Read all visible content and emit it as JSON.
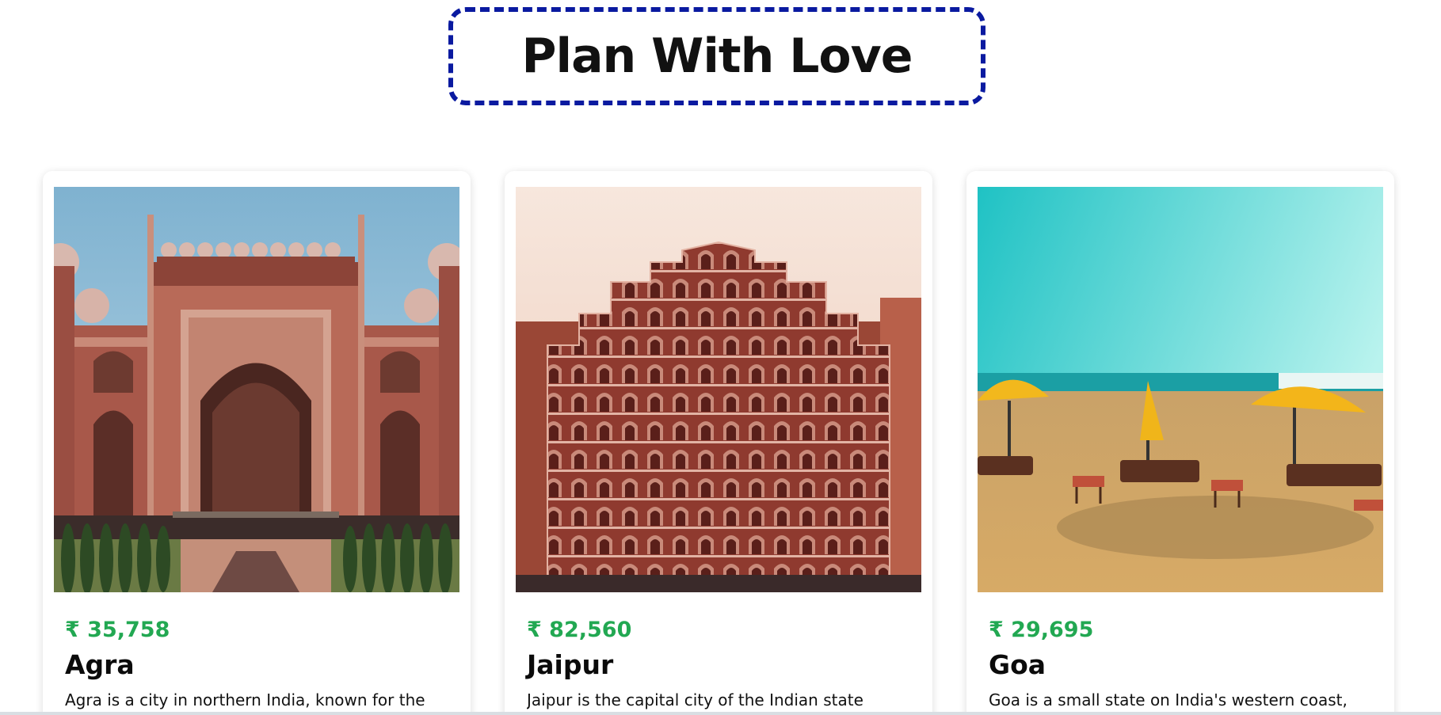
{
  "header": {
    "title": "Plan With Love"
  },
  "cards": [
    {
      "price": "₹ 35,758",
      "city": "Agra",
      "description": "Agra is a city in northern India, known for the",
      "image": "agra-gate-image"
    },
    {
      "price": "₹ 82,560",
      "city": "Jaipur",
      "description": "Jaipur is the capital city of the Indian state",
      "image": "hawa-mahal-image"
    },
    {
      "price": "₹ 29,695",
      "city": "Goa",
      "description": "Goa is a small state on India's western coast,",
      "image": "goa-beach-image"
    }
  ],
  "colors": {
    "title_border": "#0a1aa0",
    "price": "#22a852",
    "text": "#0b0b0b"
  }
}
